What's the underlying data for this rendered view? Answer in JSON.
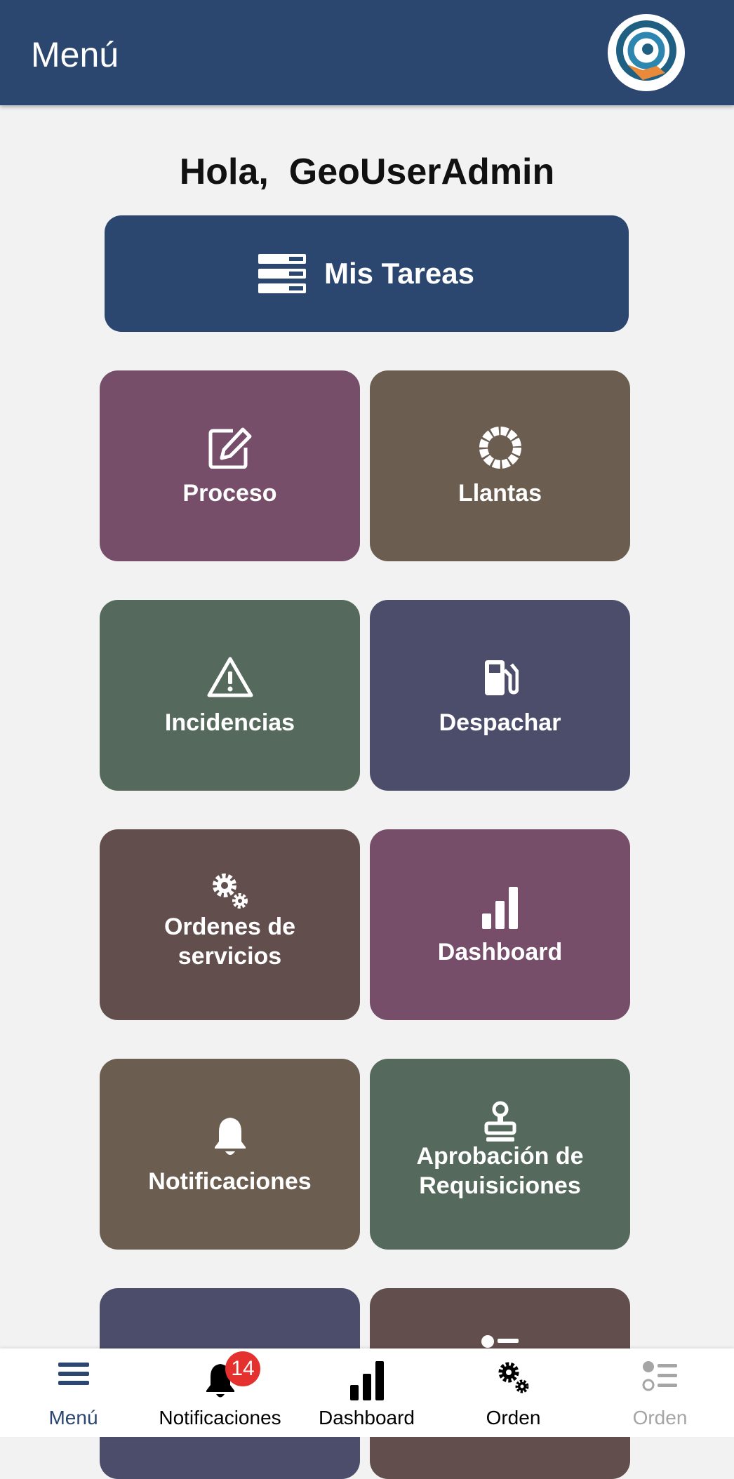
{
  "header": {
    "title": "Menú",
    "logo_icon": "app-logo-icon",
    "color": "#2b466f"
  },
  "greeting": {
    "text": "Hola,  GeoUserAdmin"
  },
  "tasks_button": {
    "label": "Mis Tareas",
    "icon": "server-stack-icon",
    "color": "#2b466f"
  },
  "tiles": [
    {
      "label": "Proceso",
      "icon": "edit-icon",
      "color": "#764e69"
    },
    {
      "label": "Llantas",
      "icon": "tire-icon",
      "color": "#6b5e50"
    },
    {
      "label": "Incidencias",
      "icon": "warning-icon",
      "color": "#556a5c"
    },
    {
      "label": "Despachar",
      "icon": "fuel-pump-icon",
      "color": "#4c4d6a"
    },
    {
      "label": "Ordenes de servicios",
      "icon": "gears-icon",
      "color": "#634e4e"
    },
    {
      "label": "Dashboard",
      "icon": "bar-chart-icon",
      "color": "#764e69"
    },
    {
      "label": "Notificaciones",
      "icon": "bell-icon",
      "color": "#6b5e50"
    },
    {
      "label": "Aprobación de Requisiciones",
      "icon": "stamp-icon",
      "color": "#556a5c"
    },
    {
      "label": "",
      "icon": "",
      "color": "#4c4d6a"
    },
    {
      "label": "",
      "icon": "list-icon",
      "color": "#634e4e"
    }
  ],
  "bottom_nav": {
    "items": [
      {
        "label": "Menú",
        "icon": "hamburger-menu-icon",
        "state": "active"
      },
      {
        "label": "Notificaciones",
        "icon": "bell-icon",
        "badge": "14"
      },
      {
        "label": "Dashboard",
        "icon": "bar-chart-icon"
      },
      {
        "label": "Orden",
        "icon": "gears-icon"
      },
      {
        "label": "Orden",
        "icon": "list-icon",
        "state": "disabled"
      }
    ],
    "active_color": "#2b466f",
    "badge_color": "#e5312d"
  }
}
